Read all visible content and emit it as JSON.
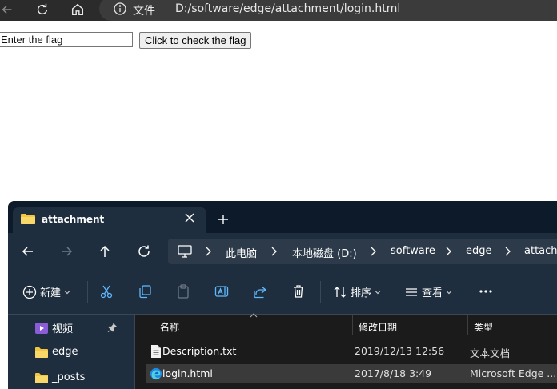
{
  "browser": {
    "address_label": "文件",
    "url": "D:/software/edge/attachment/login.html"
  },
  "page": {
    "input_placeholder": "Enter the flag",
    "button_label": "Click to check the flag"
  },
  "explorer": {
    "tab_title": "attachment",
    "breadcrumb": [
      "此电脑",
      "本地磁盘 (D:)",
      "software",
      "edge",
      "attachment"
    ],
    "commands": {
      "new_label": "新建",
      "sort_label": "排序",
      "view_label": "查看"
    },
    "nav_pane": [
      {
        "label": "视频",
        "icon": "video-folder-icon",
        "pinned": true
      },
      {
        "label": "edge",
        "icon": "folder-icon"
      },
      {
        "label": "_posts",
        "icon": "folder-icon"
      }
    ],
    "columns": [
      "名称",
      "修改日期",
      "类型"
    ],
    "files": [
      {
        "name": "Description.txt",
        "modified": "2019/12/13 12:56",
        "type": "文本文档",
        "icon": "text-file-icon"
      },
      {
        "name": "login.html",
        "modified": "2017/8/18 3:49",
        "type": "Microsoft Edge ...",
        "icon": "edge-html-icon",
        "selected": true
      }
    ]
  },
  "colors": {
    "explorer_bg": "#1f2e3e",
    "file_list_bg": "#1b1b1b",
    "accent_blue": "#60b8ff",
    "folder_yellow": "#f4c542"
  }
}
